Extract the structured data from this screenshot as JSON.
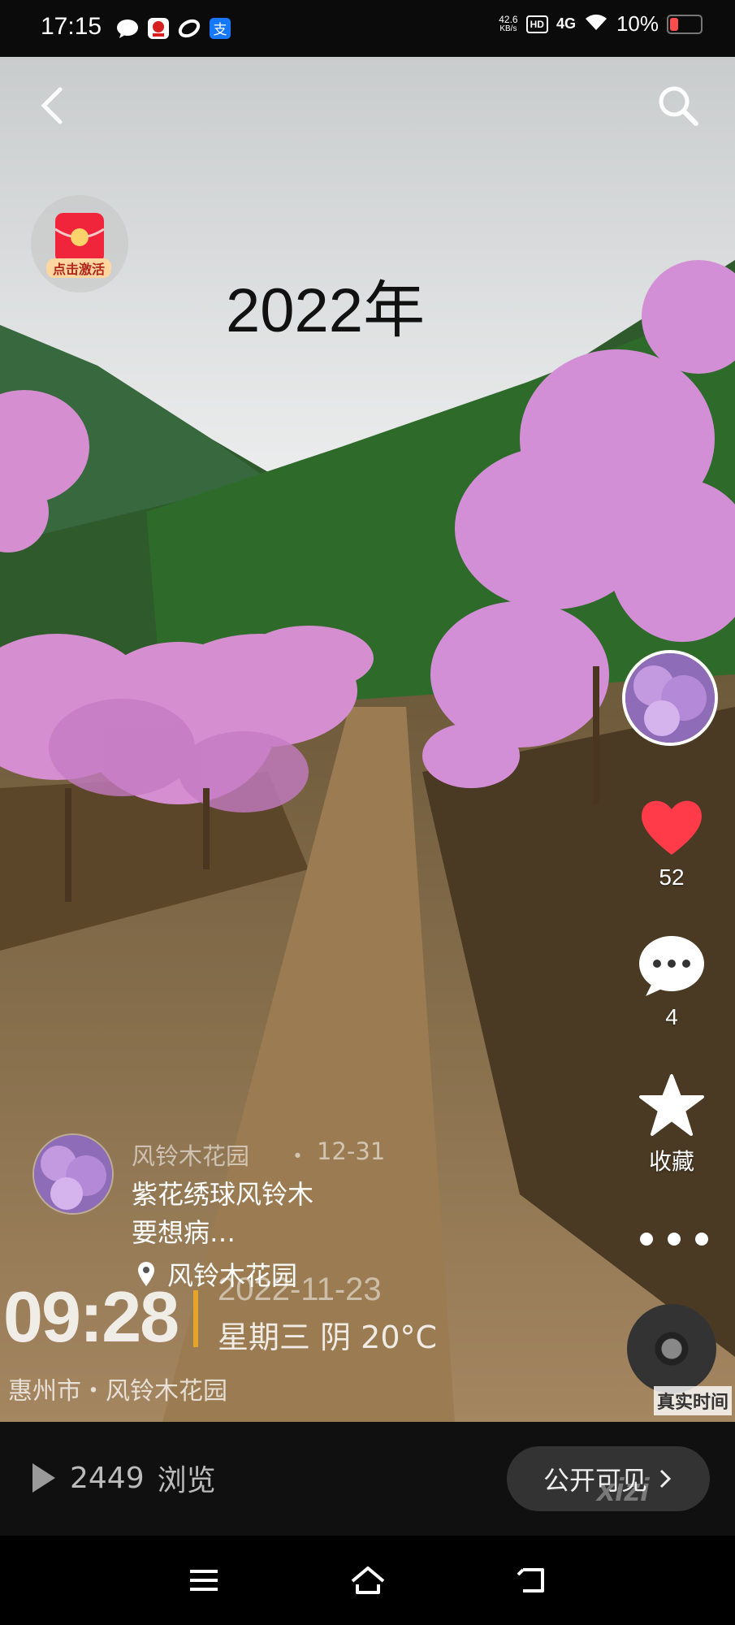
{
  "status_bar": {
    "time": "17:15",
    "speed_value": "42.6",
    "speed_unit": "KB/s",
    "hd": "HD",
    "network": "4G",
    "battery": "10%",
    "icons": [
      "message-icon",
      "app-red-icon",
      "app-swirl-icon",
      "alipay-icon",
      "wifi-icon",
      "battery-icon"
    ]
  },
  "top_controls": {
    "back_icon": "back-chevron-icon",
    "search_icon": "search-icon"
  },
  "promo": {
    "label": "点击激活"
  },
  "overlay_text": {
    "year": "2022年"
  },
  "actions": {
    "likes": "52",
    "comments": "4",
    "favorite_label": "收藏"
  },
  "post": {
    "author": "风铃木花园",
    "date": "12-31",
    "description_line1": "紫花绣球风铃木",
    "description_line2": "要想病…",
    "location": "风铃木花园"
  },
  "photo_watermark": {
    "time": "09:28",
    "date": "2022-11-23",
    "weekday_weather": "星期三 阴 20°C",
    "place": "惠州市・风铃木花园",
    "real_time_label": "真实时间"
  },
  "bottom_bar": {
    "view_count": "2449",
    "view_label": "浏览",
    "visibility_label": "公开可见",
    "site_watermark": "xizi"
  },
  "colors": {
    "like": "#ff3b4a",
    "accent_bar": "#e6a52a",
    "bottom_bg": "#101010"
  }
}
